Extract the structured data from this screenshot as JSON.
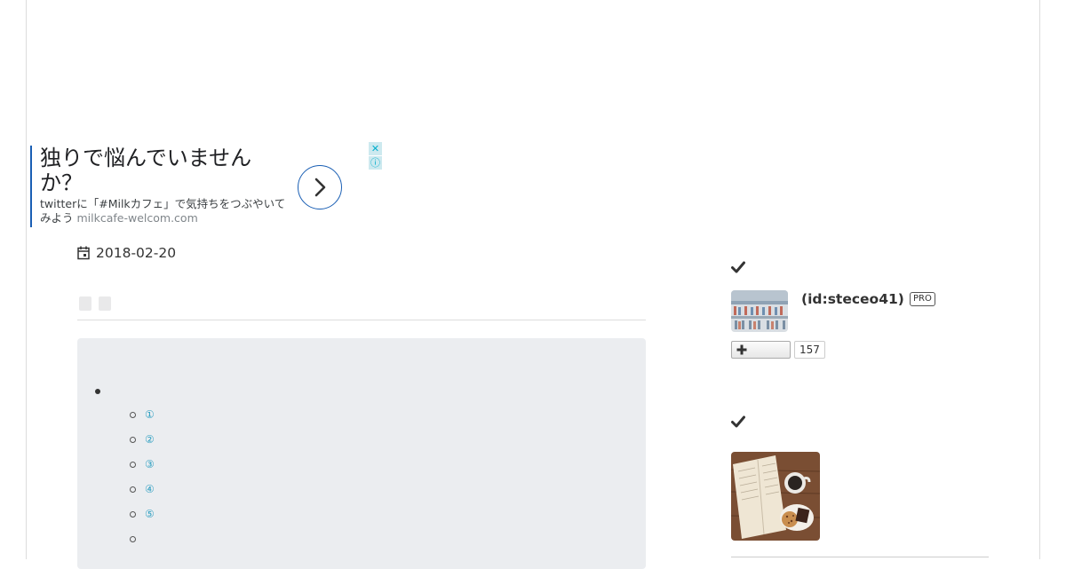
{
  "ad": {
    "headline": "独りで悩んでいませんか？",
    "description": "twitterに「#Milkカフェ」で気持ちをつぶやいてみよう",
    "url": "milkcafe-welcom.com",
    "close_glyph": "✕",
    "info_glyph": "ⓘ",
    "arrow_icon": "chevron-right-icon",
    "accent_color": "#1a5fb4"
  },
  "article": {
    "date": "2018-02-20",
    "date_icon": "calendar-icon"
  },
  "toc": {
    "items": [
      "①",
      "②",
      "③",
      "④",
      "⑤",
      ""
    ]
  },
  "sidebar": {
    "profile": {
      "name": "(id:steceo41)",
      "badge": "PRO",
      "follow_count": "157",
      "follow_glyph": "+"
    }
  },
  "colors": {
    "link": "#2f9fc1",
    "toc_background": "#ebedf0"
  }
}
